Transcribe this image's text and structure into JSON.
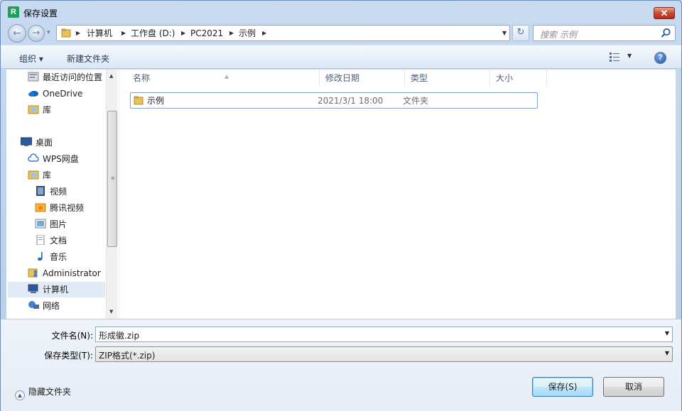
{
  "window": {
    "title": "保存设置",
    "app_icon": "app-icon"
  },
  "address": {
    "crumbs": [
      "计算机",
      "工作盘 (D:)",
      "PC2021",
      "示例"
    ],
    "search_placeholder": "搜索 示例"
  },
  "toolbar": {
    "organize": "组织 ▾",
    "new_folder": "新建文件夹"
  },
  "nav": {
    "items": [
      {
        "label": "最近访问的位置",
        "icon": "recent-places-icon"
      },
      {
        "label": "OneDrive",
        "icon": "onedrive-icon"
      },
      {
        "label": "库",
        "icon": "library-icon"
      },
      {
        "label": "桌面",
        "icon": "desktop-icon"
      },
      {
        "label": "WPS网盘",
        "icon": "wps-cloud-icon"
      },
      {
        "label": "库",
        "icon": "library-icon"
      },
      {
        "label": "视频",
        "icon": "video-icon"
      },
      {
        "label": "腾讯视频",
        "icon": "tencent-video-icon"
      },
      {
        "label": "图片",
        "icon": "pictures-icon"
      },
      {
        "label": "文档",
        "icon": "documents-icon"
      },
      {
        "label": "音乐",
        "icon": "music-icon"
      },
      {
        "label": "Administrator",
        "icon": "user-folder-icon"
      },
      {
        "label": "计算机",
        "icon": "computer-icon"
      },
      {
        "label": "网络",
        "icon": "network-icon"
      }
    ],
    "selected": "计算机"
  },
  "files": {
    "columns": [
      "名称",
      "修改日期",
      "类型",
      "大小"
    ],
    "rows": [
      {
        "name": "示例",
        "modified": "2021/3/1 18:00",
        "type": "文件夹",
        "size": ""
      }
    ]
  },
  "form": {
    "filename_label": "文件名(N):",
    "filename_value": "形成徽.zip",
    "filetype_label": "保存类型(T):",
    "filetype_value": "ZIP格式(*.zip)"
  },
  "footer": {
    "hide_folders": "隐藏文件夹",
    "save": "保存(S)",
    "cancel": "取消"
  },
  "colors": {
    "accent": "#3c7fb1",
    "close": "#c74a36",
    "selection": "#e1ebf7"
  }
}
